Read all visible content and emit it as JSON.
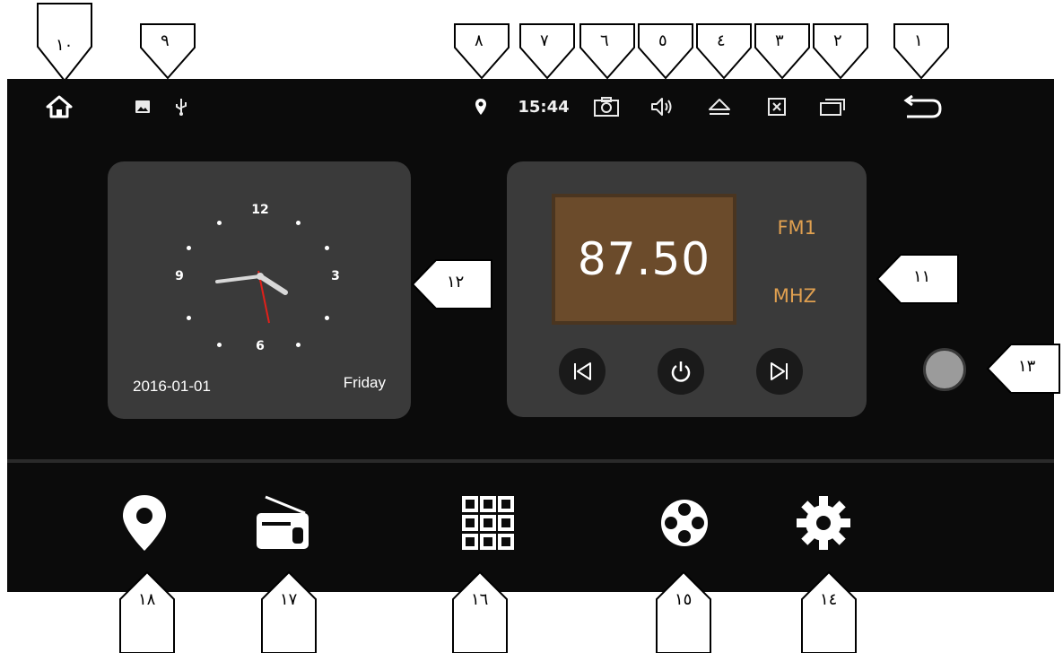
{
  "status_bar": {
    "time": "15:44",
    "icons": [
      "home-icon",
      "image-icon",
      "usb-icon",
      "location-pin-icon",
      "camera-icon",
      "volume-icon",
      "eject-icon",
      "close-box-icon",
      "recent-apps-icon",
      "back-icon"
    ]
  },
  "clock_widget": {
    "numbers": {
      "twelve": "12",
      "three": "3",
      "six": "6",
      "nine": "9"
    },
    "date": "2016-01-01",
    "day": "Friday"
  },
  "radio_widget": {
    "frequency": "87.50",
    "band": "FM1",
    "unit": "MHZ",
    "controls": [
      "previous-icon",
      "power-icon",
      "next-icon"
    ]
  },
  "dock": {
    "icons": [
      "navigation-icon",
      "radio-icon",
      "apps-grid-icon",
      "media-reel-icon",
      "settings-icon"
    ]
  },
  "callouts": {
    "c1": "١",
    "c2": "٢",
    "c3": "٣",
    "c4": "٤",
    "c5": "٥",
    "c6": "٦",
    "c7": "٧",
    "c8": "٨",
    "c9": "٩",
    "c10": "١٠",
    "c11": "١١",
    "c12": "١٢",
    "c13": "١٣",
    "c14": "١٤",
    "c15": "١٥",
    "c16": "١٦",
    "c17": "١٧",
    "c18": "١٨"
  },
  "colors": {
    "screen": "#0b0b0b",
    "widget": "#3a3a3a",
    "freq_bg": "#6b4b2b",
    "band": "#e0a050"
  }
}
